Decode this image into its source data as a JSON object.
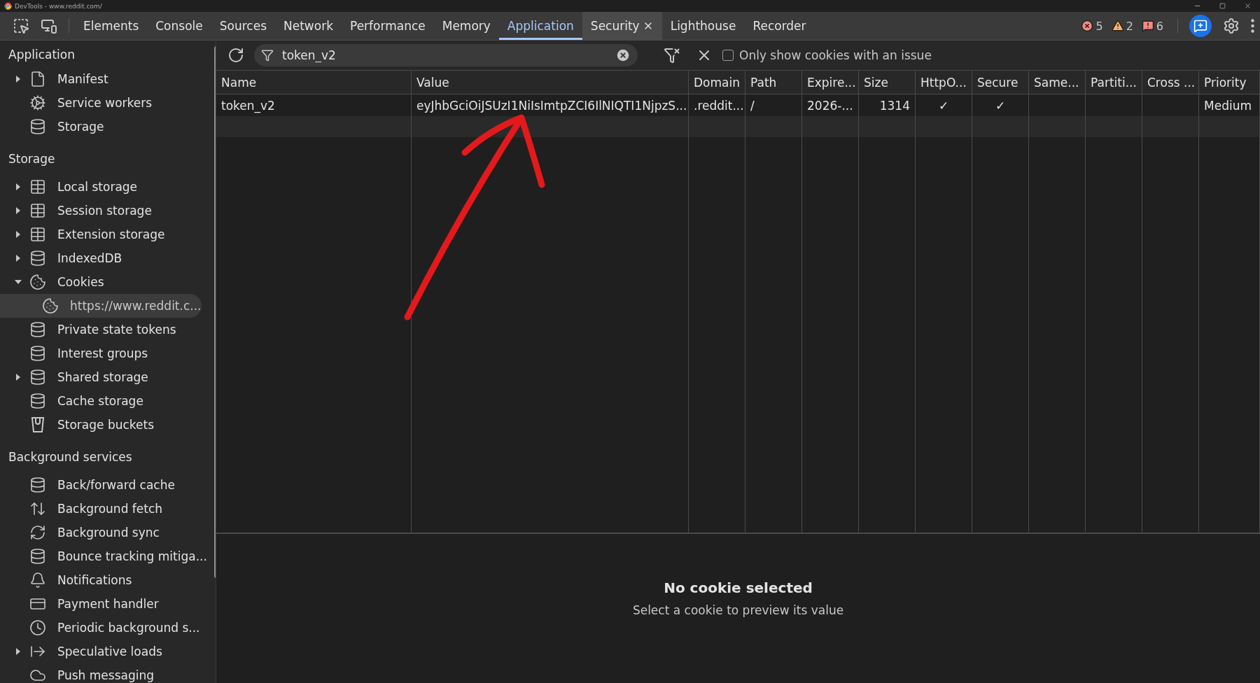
{
  "title_bar": {
    "title": "DevTools - www.reddit.com/"
  },
  "tabs": [
    {
      "label": "Elements",
      "selected": false,
      "closable": false
    },
    {
      "label": "Console",
      "selected": false,
      "closable": false
    },
    {
      "label": "Sources",
      "selected": false,
      "closable": false
    },
    {
      "label": "Network",
      "selected": false,
      "closable": false
    },
    {
      "label": "Performance",
      "selected": false,
      "closable": false
    },
    {
      "label": "Memory",
      "selected": false,
      "closable": false
    },
    {
      "label": "Application",
      "selected": true,
      "closable": false
    },
    {
      "label": "Security",
      "selected": false,
      "closable": true
    },
    {
      "label": "Lighthouse",
      "selected": false,
      "closable": false
    },
    {
      "label": "Recorder",
      "selected": false,
      "closable": false
    }
  ],
  "counters": [
    {
      "kind": "error",
      "count": "5"
    },
    {
      "kind": "warning",
      "count": "2"
    },
    {
      "kind": "issue",
      "count": "6"
    }
  ],
  "sidebar": {
    "sections": [
      {
        "title": "Application",
        "items": [
          {
            "label": "Manifest",
            "kind": "file",
            "expanded": false,
            "selected": false
          },
          {
            "label": "Service workers",
            "kind": "gears",
            "selected": false
          },
          {
            "label": "Storage",
            "kind": "database",
            "selected": false
          }
        ]
      },
      {
        "title": "Storage",
        "items": [
          {
            "label": "Local storage",
            "kind": "table",
            "expanded": false,
            "selected": false
          },
          {
            "label": "Session storage",
            "kind": "table",
            "expanded": false,
            "selected": false
          },
          {
            "label": "Extension storage",
            "kind": "table",
            "expanded": false,
            "selected": false
          },
          {
            "label": "IndexedDB",
            "kind": "database",
            "expanded": false,
            "selected": false
          },
          {
            "label": "Cookies",
            "kind": "cookie",
            "expanded": true,
            "selected": false,
            "children": [
              {
                "label": "https://www.reddit.c...",
                "kind": "cookie",
                "selected": true
              }
            ]
          },
          {
            "label": "Private state tokens",
            "kind": "database",
            "selected": false
          },
          {
            "label": "Interest groups",
            "kind": "database",
            "selected": false
          },
          {
            "label": "Shared storage",
            "kind": "database",
            "expanded": false,
            "selected": false
          },
          {
            "label": "Cache storage",
            "kind": "database",
            "selected": false
          },
          {
            "label": "Storage buckets",
            "kind": "bucket",
            "selected": false
          }
        ]
      },
      {
        "title": "Background services",
        "items": [
          {
            "label": "Back/forward cache",
            "kind": "database",
            "selected": false
          },
          {
            "label": "Background fetch",
            "kind": "transfer",
            "selected": false
          },
          {
            "label": "Background sync",
            "kind": "sync",
            "selected": false
          },
          {
            "label": "Bounce tracking mitiga...",
            "kind": "database",
            "selected": false
          },
          {
            "label": "Notifications",
            "kind": "bell",
            "selected": false
          },
          {
            "label": "Payment handler",
            "kind": "card",
            "selected": false
          },
          {
            "label": "Periodic background s...",
            "kind": "clock",
            "selected": false
          },
          {
            "label": "Speculative loads",
            "kind": "load",
            "expanded": false,
            "selected": false
          },
          {
            "label": "Push messaging",
            "kind": "cloud",
            "selected": false
          }
        ]
      }
    ]
  },
  "toolbar": {
    "filter": {
      "value": "token_v2"
    },
    "issue_checkbox": {
      "label": "Only show cookies with an issue",
      "checked": false
    }
  },
  "table": {
    "columns": [
      "Name",
      "Value",
      "Domain",
      "Path",
      "Expire...",
      "Size",
      "HttpO...",
      "Secure",
      "Same...",
      "Partiti...",
      "Cross ...",
      "Priority"
    ],
    "rows": [
      {
        "cells": [
          "token_v2",
          "eyJhbGciOiJSUzI1NiIsImtpZCI6IlNIQTI1NjpzS...",
          ".reddit...",
          "/",
          "2026-...",
          "1314",
          "✓",
          "✓",
          null,
          null,
          null,
          "Medium"
        ]
      }
    ]
  },
  "detail": {
    "title": "No cookie selected",
    "hint": "Select a cookie to preview its value"
  }
}
